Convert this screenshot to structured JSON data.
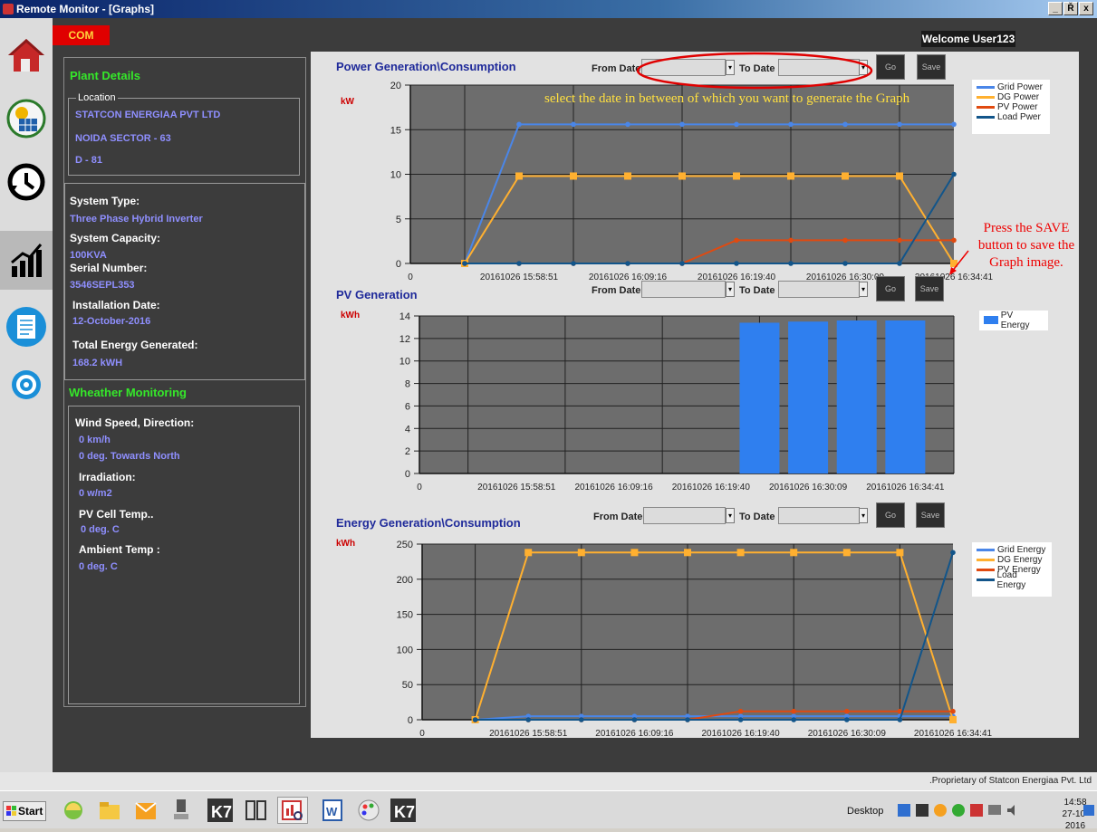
{
  "window": {
    "title": "Remote Monitor - [Graphs]",
    "btn_min": "_",
    "btn_max": "Ř",
    "btn_close": "x"
  },
  "nav": {
    "icons": [
      "home-icon",
      "solar-panel-icon",
      "clock-history-icon",
      "graph-chart-icon",
      "document-icon",
      "settings-gear-icon"
    ]
  },
  "header": {
    "com_label": "COM",
    "welcome": "Welcome User123"
  },
  "plant": {
    "title": "Plant Details",
    "location_legend": "Location",
    "location_lines": [
      "STATCON ENERGIAA PVT LTD",
      "NOIDA SECTOR - 63",
      "D - 81"
    ]
  },
  "system": {
    "type_label": "System Type:",
    "type_value": "Three Phase Hybrid Inverter",
    "capacity_label": "System Capacity:",
    "capacity_value": "100KVA",
    "serial_label": "Serial Number:",
    "serial_value": "3546SEPL353",
    "install_label": "Installation Date:",
    "install_value": "12-October-2016",
    "energy_label": "Total Energy Generated:",
    "energy_value": "168.2 kWH"
  },
  "weather": {
    "title": "Wheather Monitoring",
    "wind_label": "Wind Speed, Direction:",
    "wind_speed": "0 km/h",
    "wind_dir": "0 deg. Towards North",
    "irr_label": "Irradiation:",
    "irr_value": "0 w/m2",
    "cell_label": "PV Cell Temp..",
    "cell_value": "0 deg. C",
    "amb_label": "Ambient Temp :",
    "amb_value": "0 deg. C"
  },
  "controls": {
    "from_label": "From Date",
    "to_label": "To Date",
    "go": "Go",
    "save": "Save"
  },
  "annotations": {
    "select_hint": "select the date in between of which you want to generate the Graph",
    "save_hint": "Press the SAVE button to save the Graph image."
  },
  "chart_data": [
    {
      "type": "line",
      "title": "Power Generation\\Consumption",
      "ylabel": "kW",
      "ylim": [
        0,
        20
      ],
      "yticks": [
        0,
        5,
        10,
        15,
        20
      ],
      "x": [
        1,
        2,
        3,
        4,
        5,
        6,
        7,
        8,
        9,
        10
      ],
      "x_origin_label": "0",
      "xtick_labels": [
        "20161026 15:58:51",
        "20161026 16:09:16",
        "20161026 16:19:40",
        "20161026 16:30:09",
        "20161026 16:34:41"
      ],
      "xtick_positions": [
        2,
        4,
        6,
        8,
        10
      ],
      "legend": "right",
      "series": [
        {
          "name": "Grid Power",
          "color": "#4a86e8",
          "values": [
            0,
            15.6,
            15.6,
            15.6,
            15.6,
            15.6,
            15.6,
            15.6,
            15.6,
            15.6
          ]
        },
        {
          "name": "DG Power",
          "color": "#ffb030",
          "values": [
            0,
            9.8,
            9.8,
            9.8,
            9.8,
            9.8,
            9.8,
            9.8,
            9.8,
            0
          ]
        },
        {
          "name": "PV Power",
          "color": "#e04a10",
          "values": [
            0,
            0,
            0,
            0,
            0,
            2.6,
            2.6,
            2.6,
            2.6,
            2.6
          ]
        },
        {
          "name": "Load Pwer",
          "color": "#12558a",
          "values": [
            0,
            0,
            0,
            0,
            0,
            0,
            0,
            0,
            0,
            10
          ]
        }
      ]
    },
    {
      "type": "bar",
      "title": "PV Generation",
      "ylabel": "kWh",
      "ylim": [
        0,
        14
      ],
      "yticks": [
        0,
        2,
        4,
        6,
        8,
        10,
        12,
        14
      ],
      "x": [
        7,
        8,
        9,
        10
      ],
      "x_origin_label": "0",
      "xtick_labels": [
        "20161026 15:58:51",
        "20161026 16:09:16",
        "20161026 16:19:40",
        "20161026 16:30:09",
        "20161026 16:34:41"
      ],
      "xtick_positions": [
        2,
        4,
        6,
        8,
        10
      ],
      "legend": "right",
      "series": [
        {
          "name": "PV Energy",
          "color": "#2f7fef",
          "values": [
            13.4,
            13.5,
            13.6,
            13.6
          ]
        }
      ]
    },
    {
      "type": "line",
      "title": "Energy Generation\\Consumption",
      "ylabel": "kWh",
      "ylim": [
        0,
        250
      ],
      "yticks": [
        0,
        50,
        100,
        150,
        200,
        250
      ],
      "x": [
        1,
        2,
        3,
        4,
        5,
        6,
        7,
        8,
        9,
        10
      ],
      "x_origin_label": "0",
      "xtick_labels": [
        "20161026 15:58:51",
        "20161026 16:09:16",
        "20161026 16:19:40",
        "20161026 16:30:09",
        "20161026 16:34:41"
      ],
      "xtick_positions": [
        2,
        4,
        6,
        8,
        10
      ],
      "legend": "right",
      "series": [
        {
          "name": "Grid Energy",
          "color": "#4a86e8",
          "values": [
            0,
            5,
            5,
            5,
            5,
            5,
            5,
            5,
            5,
            5
          ]
        },
        {
          "name": "DG Energy",
          "color": "#ffb030",
          "values": [
            0,
            238,
            238,
            238,
            238,
            238,
            238,
            238,
            238,
            0
          ]
        },
        {
          "name": "PV Energy",
          "color": "#e04a10",
          "values": [
            0,
            0,
            0,
            0,
            0,
            12,
            12,
            12,
            12,
            12
          ]
        },
        {
          "name": "Load Energy",
          "color": "#12558a",
          "values": [
            0,
            0,
            0,
            0,
            0,
            0,
            0,
            0,
            0,
            238
          ]
        }
      ]
    }
  ],
  "status": {
    "proprietary": ".Proprietary of Statcon Energiaa Pvt. Ltd"
  },
  "taskbar": {
    "start": "Start",
    "desktop": "Desktop",
    "time": "14:58",
    "date": "27-10-2016"
  }
}
